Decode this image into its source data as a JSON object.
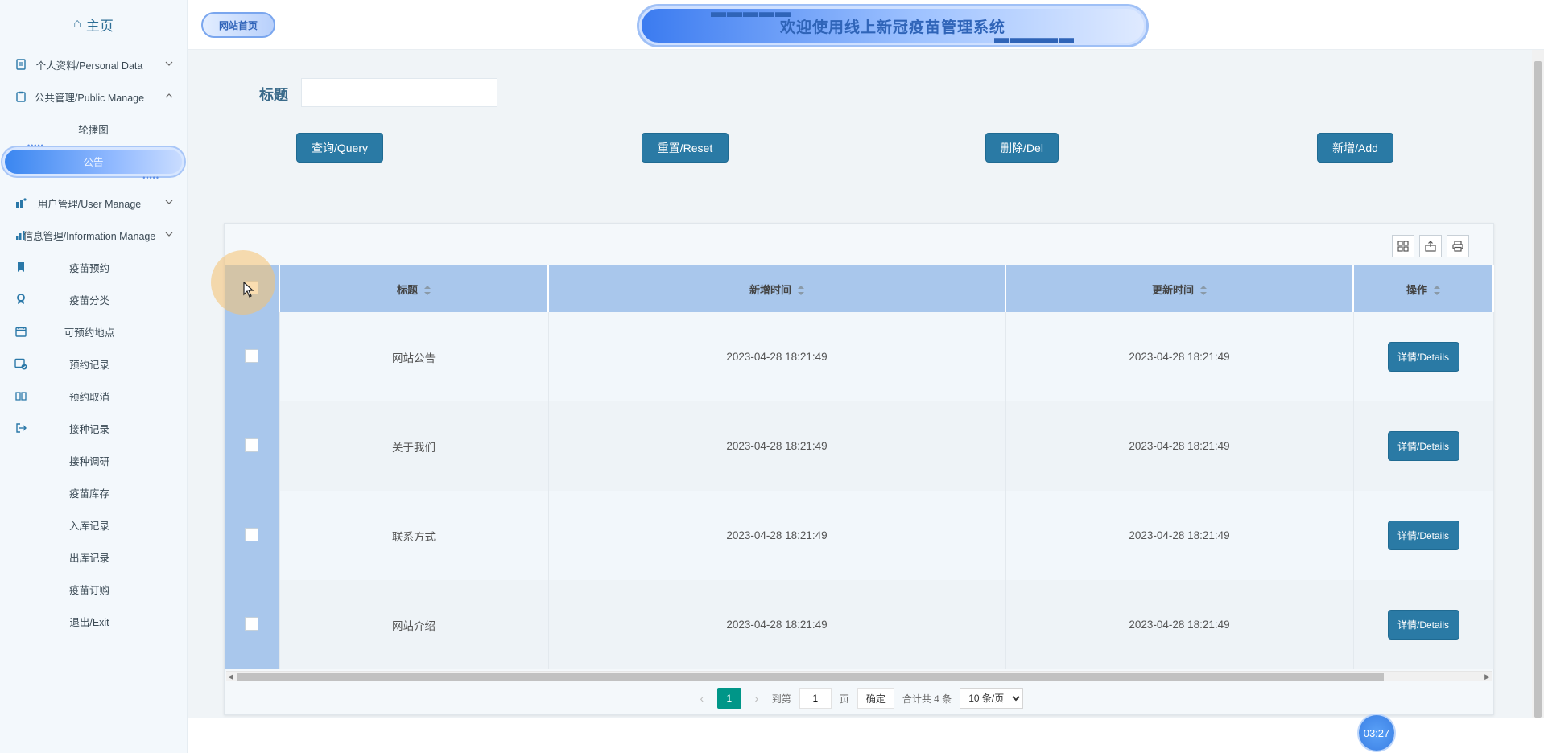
{
  "sidebar": {
    "home_label": "主页",
    "items": [
      {
        "label": "个人资料/Personal Data",
        "icon": "profile-icon",
        "expandable": true
      },
      {
        "label": "公共管理/Public Manage",
        "icon": "clipboard-icon",
        "expandable": true,
        "expanded": true
      },
      {
        "label": "轮播图",
        "sub": true
      },
      {
        "label": "公告",
        "sub": true,
        "active": true
      },
      {
        "label": "用户管理/User Manage",
        "icon": "users-icon",
        "expandable": true
      },
      {
        "label": "信息管理/Information Manage",
        "icon": "chart-icon",
        "expandable": true
      },
      {
        "label": "疫苗预约",
        "icon": "bookmark-icon"
      },
      {
        "label": "疫苗分类",
        "icon": "award-icon"
      },
      {
        "label": "可预约地点",
        "icon": "calendar-icon"
      },
      {
        "label": "预约记录",
        "icon": "calendar-check-icon"
      },
      {
        "label": "预约取消",
        "icon": "book-icon"
      },
      {
        "label": "接种记录",
        "icon": "exit-arrow-icon"
      },
      {
        "label": "接种调研"
      },
      {
        "label": "疫苗库存"
      },
      {
        "label": "入库记录"
      },
      {
        "label": "出库记录"
      },
      {
        "label": "疫苗订购"
      },
      {
        "label": "退出/Exit"
      }
    ]
  },
  "header": {
    "brand": "网站首页",
    "title": "欢迎使用线上新冠疫苗管理系统"
  },
  "search": {
    "label": "标题",
    "value": "",
    "placeholder": ""
  },
  "buttons": {
    "query": "查询/Query",
    "reset": "重置/Reset",
    "delete": "删除/Del",
    "add": "新增/Add"
  },
  "table": {
    "columns": [
      "标题",
      "新增时间",
      "更新时间",
      "操作"
    ],
    "rows": [
      {
        "title": "网站公告",
        "created": "2023-04-28 18:21:49",
        "updated": "2023-04-28 18:21:49",
        "action": "详情/Details"
      },
      {
        "title": "关于我们",
        "created": "2023-04-28 18:21:49",
        "updated": "2023-04-28 18:21:49",
        "action": "详情/Details"
      },
      {
        "title": "联系方式",
        "created": "2023-04-28 18:21:49",
        "updated": "2023-04-28 18:21:49",
        "action": "详情/Details"
      },
      {
        "title": "网站介绍",
        "created": "2023-04-28 18:21:49",
        "updated": "2023-04-28 18:21:49",
        "action": "详情/Details"
      }
    ]
  },
  "pagination": {
    "current_page": "1",
    "goto_label": "到第",
    "goto_value": "1",
    "page_unit": "页",
    "confirm": "确定",
    "total": "合计共 4 条",
    "per_page": "10 条/页"
  },
  "timer": "03:27",
  "colors": {
    "primary_button": "#2a7aa5",
    "table_header": "#a9c7ec",
    "pager_active": "#009688",
    "accent_blue": "#3a86f0"
  }
}
